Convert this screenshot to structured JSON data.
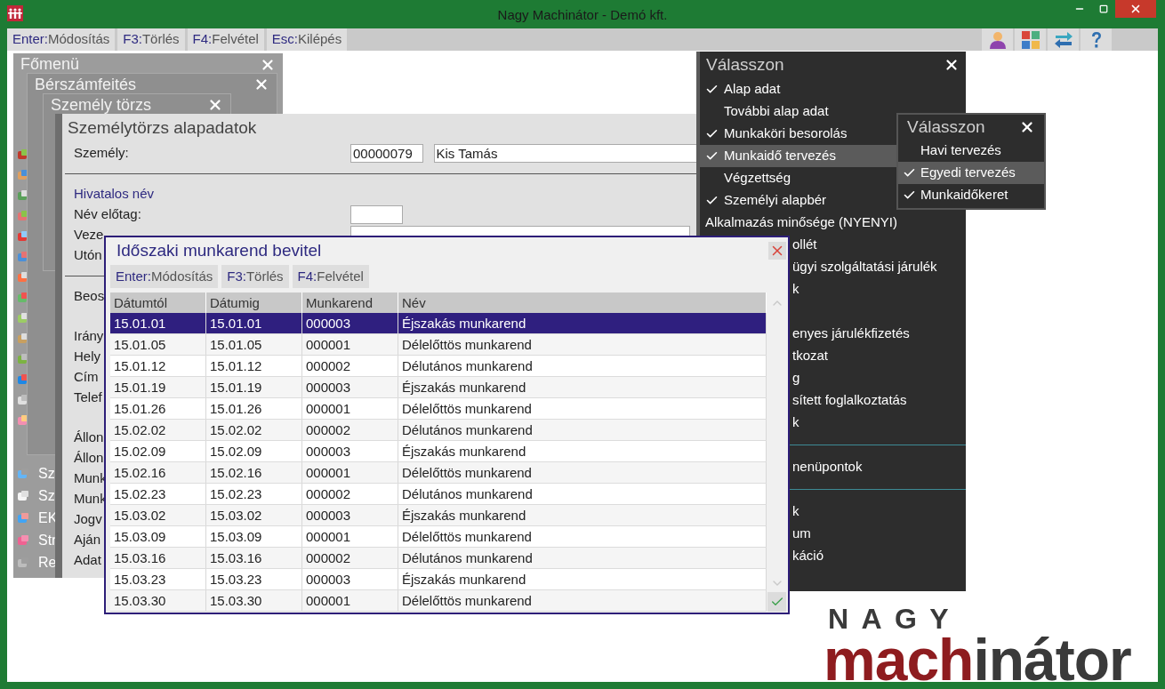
{
  "window": {
    "title": "Nagy Machinátor - Demó kft."
  },
  "toolbar": [
    {
      "key": "Enter:",
      "label": "Módosítás"
    },
    {
      "key": "F3:",
      "label": "Törlés"
    },
    {
      "key": "F4:",
      "label": "Felvétel"
    },
    {
      "key": "Esc:",
      "label": "Kilépés"
    }
  ],
  "main_menu": {
    "title": "Főmenü",
    "items": [
      {
        "label": "Sz"
      },
      {
        "label": "Sz"
      },
      {
        "label": "EK"
      },
      {
        "label": "Str"
      },
      {
        "label": "Re"
      }
    ]
  },
  "payroll_window": {
    "title": "Bérszámfeités"
  },
  "person_window": {
    "title": "Személy törzs"
  },
  "person_form": {
    "title": "Személytörzs alapadatok",
    "rows": [
      {
        "kind": "field",
        "label": "Személy:",
        "inputs": [
          {
            "kind": "code",
            "value": "00000079"
          },
          {
            "kind": "wide",
            "value": "Kis Tamás"
          }
        ]
      },
      {
        "kind": "divider"
      },
      {
        "kind": "section",
        "label": "Hivatalos név"
      },
      {
        "kind": "field",
        "label": "Név előtag:",
        "inputs": [
          {
            "kind": "short"
          }
        ]
      },
      {
        "kind": "field",
        "label": "Veze",
        "inputs": [
          {
            "kind": "long"
          }
        ]
      },
      {
        "kind": "field",
        "label": "Utón"
      },
      {
        "kind": "divider"
      },
      {
        "kind": "field",
        "label": "Beos"
      },
      {
        "kind": "gap"
      },
      {
        "kind": "field",
        "label": "Irány"
      },
      {
        "kind": "field",
        "label": "Hely"
      },
      {
        "kind": "field",
        "label": "Cím"
      },
      {
        "kind": "field",
        "label": "Telef"
      },
      {
        "kind": "gap"
      },
      {
        "kind": "field",
        "label": "Állon"
      },
      {
        "kind": "field",
        "label": "Állon"
      },
      {
        "kind": "field",
        "label": "Munk"
      },
      {
        "kind": "field",
        "label": "Munk"
      },
      {
        "kind": "field",
        "label": "Jogv"
      },
      {
        "kind": "field",
        "label": "Aján"
      },
      {
        "kind": "field",
        "label": "Adat"
      }
    ]
  },
  "dialog": {
    "title": "Időszaki munkarend bevitel",
    "toolbar": [
      {
        "key": "Enter:",
        "label": "Módosítás"
      },
      {
        "key": "F3:",
        "label": "Törlés"
      },
      {
        "key": "F4:",
        "label": "Felvétel"
      }
    ],
    "table": {
      "columns": [
        "Dátumtól",
        "Dátumig",
        "Munkarend",
        "Név"
      ],
      "rows": [
        {
          "selected": true,
          "cells": [
            "15.01.01",
            "15.01.01",
            "000003",
            "Éjszakás munkarend"
          ]
        },
        {
          "selected": false,
          "cells": [
            "15.01.05",
            "15.01.05",
            "000001",
            "Délelőttös munkarend"
          ]
        },
        {
          "selected": false,
          "cells": [
            "15.01.12",
            "15.01.12",
            "000002",
            "Délutános munkarend"
          ]
        },
        {
          "selected": false,
          "cells": [
            "15.01.19",
            "15.01.19",
            "000003",
            "Éjszakás munkarend"
          ]
        },
        {
          "selected": false,
          "cells": [
            "15.01.26",
            "15.01.26",
            "000001",
            "Délelőttös munkarend"
          ]
        },
        {
          "selected": false,
          "cells": [
            "15.02.02",
            "15.02.02",
            "000002",
            "Délutános munkarend"
          ]
        },
        {
          "selected": false,
          "cells": [
            "15.02.09",
            "15.02.09",
            "000003",
            "Éjszakás munkarend"
          ]
        },
        {
          "selected": false,
          "cells": [
            "15.02.16",
            "15.02.16",
            "000001",
            "Délelőttös munkarend"
          ]
        },
        {
          "selected": false,
          "cells": [
            "15.02.23",
            "15.02.23",
            "000002",
            "Délutános munkarend"
          ]
        },
        {
          "selected": false,
          "cells": [
            "15.03.02",
            "15.03.02",
            "000003",
            "Éjszakás munkarend"
          ]
        },
        {
          "selected": false,
          "cells": [
            "15.03.09",
            "15.03.09",
            "000001",
            "Délelőttös munkarend"
          ]
        },
        {
          "selected": false,
          "cells": [
            "15.03.16",
            "15.03.16",
            "000002",
            "Délutános munkarend"
          ]
        },
        {
          "selected": false,
          "cells": [
            "15.03.23",
            "15.03.23",
            "000003",
            "Éjszakás munkarend"
          ]
        },
        {
          "selected": false,
          "cells": [
            "15.03.30",
            "15.03.30",
            "000001",
            "Délelőttös munkarend"
          ]
        }
      ]
    }
  },
  "choice_menu": {
    "title": "Válasszon",
    "items": [
      {
        "kind": "item",
        "label": "Alap adat",
        "checked": true,
        "selected": false
      },
      {
        "kind": "item",
        "label": "További alap adat",
        "checked": false,
        "selected": false
      },
      {
        "kind": "item",
        "label": "Munkaköri besorolás",
        "checked": true,
        "selected": false
      },
      {
        "kind": "item",
        "label": "Munkaidő tervezés",
        "checked": true,
        "selected": true
      },
      {
        "kind": "item",
        "label": "Végzettség",
        "checked": false,
        "selected": false
      },
      {
        "kind": "item",
        "label": "Személyi alapbér",
        "checked": true,
        "selected": false
      },
      {
        "kind": "item",
        "label": "Alkalmazás minősége (NYENYI)",
        "checked": false,
        "selected": false
      },
      {
        "kind": "cut",
        "label": "ollét"
      },
      {
        "kind": "cut",
        "label": "ügyi szolgáltatási járulék"
      },
      {
        "kind": "cut",
        "label": "k"
      },
      {
        "kind": "gap"
      },
      {
        "kind": "cut",
        "label": "enyes járulékfizetés"
      },
      {
        "kind": "cut",
        "label": "tkozat"
      },
      {
        "kind": "cut",
        "label": "g"
      },
      {
        "kind": "cut",
        "label": "sített foglalkoztatás"
      },
      {
        "kind": "cut",
        "label": "k"
      },
      {
        "kind": "divider"
      },
      {
        "kind": "cut",
        "label": "nenüpontok"
      },
      {
        "kind": "divider"
      },
      {
        "kind": "cut",
        "label": "k"
      },
      {
        "kind": "cut",
        "label": "um"
      },
      {
        "kind": "cut",
        "label": "káció"
      }
    ]
  },
  "submenu": {
    "title": "Válasszon",
    "items": [
      {
        "label": "Havi tervezés",
        "checked": false,
        "selected": false
      },
      {
        "label": "Egyedi tervezés",
        "checked": true,
        "selected": true
      },
      {
        "label": "Munkaidőkeret",
        "checked": true,
        "selected": false
      }
    ]
  },
  "logo": {
    "top": "NAGY",
    "parts": [
      {
        "text": "mach",
        "color": "#8e1c1f"
      },
      {
        "text": "inátor",
        "color": "#3a3a3a"
      }
    ]
  }
}
